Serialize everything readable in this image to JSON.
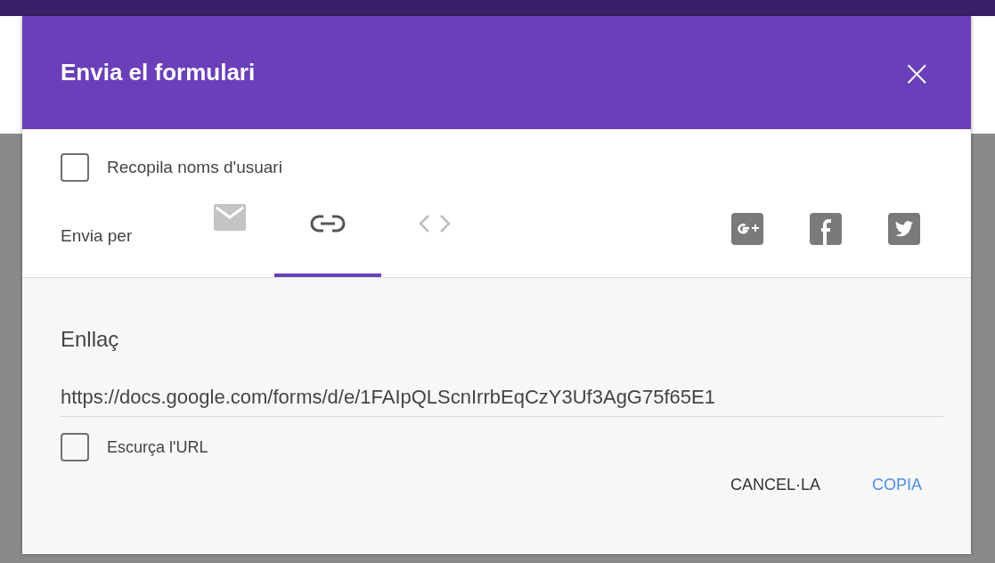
{
  "dialog": {
    "title": "Envia el formulari",
    "close": "×"
  },
  "collect_usernames": {
    "label": "Recopila noms d'usuari",
    "checked": false
  },
  "send_via": {
    "label": "Envia per",
    "tabs": [
      {
        "kind": "email",
        "selected": false
      },
      {
        "kind": "link",
        "selected": true
      },
      {
        "kind": "embed",
        "selected": false
      }
    ],
    "share": [
      {
        "kind": "gplus"
      },
      {
        "kind": "facebook"
      },
      {
        "kind": "twitter"
      }
    ]
  },
  "link_section": {
    "heading": "Enllaç",
    "url": "https://docs.google.com/forms/d/e/1FAIpQLScnIrrbEqCzY3Uf3AgG75f65E1",
    "shorten": {
      "label": "Escurça l'URL",
      "checked": false
    }
  },
  "buttons": [
    {
      "label": "CANCEL·LA",
      "kind": "secondary"
    },
    {
      "label": "COPIA",
      "kind": "primary"
    }
  ]
}
